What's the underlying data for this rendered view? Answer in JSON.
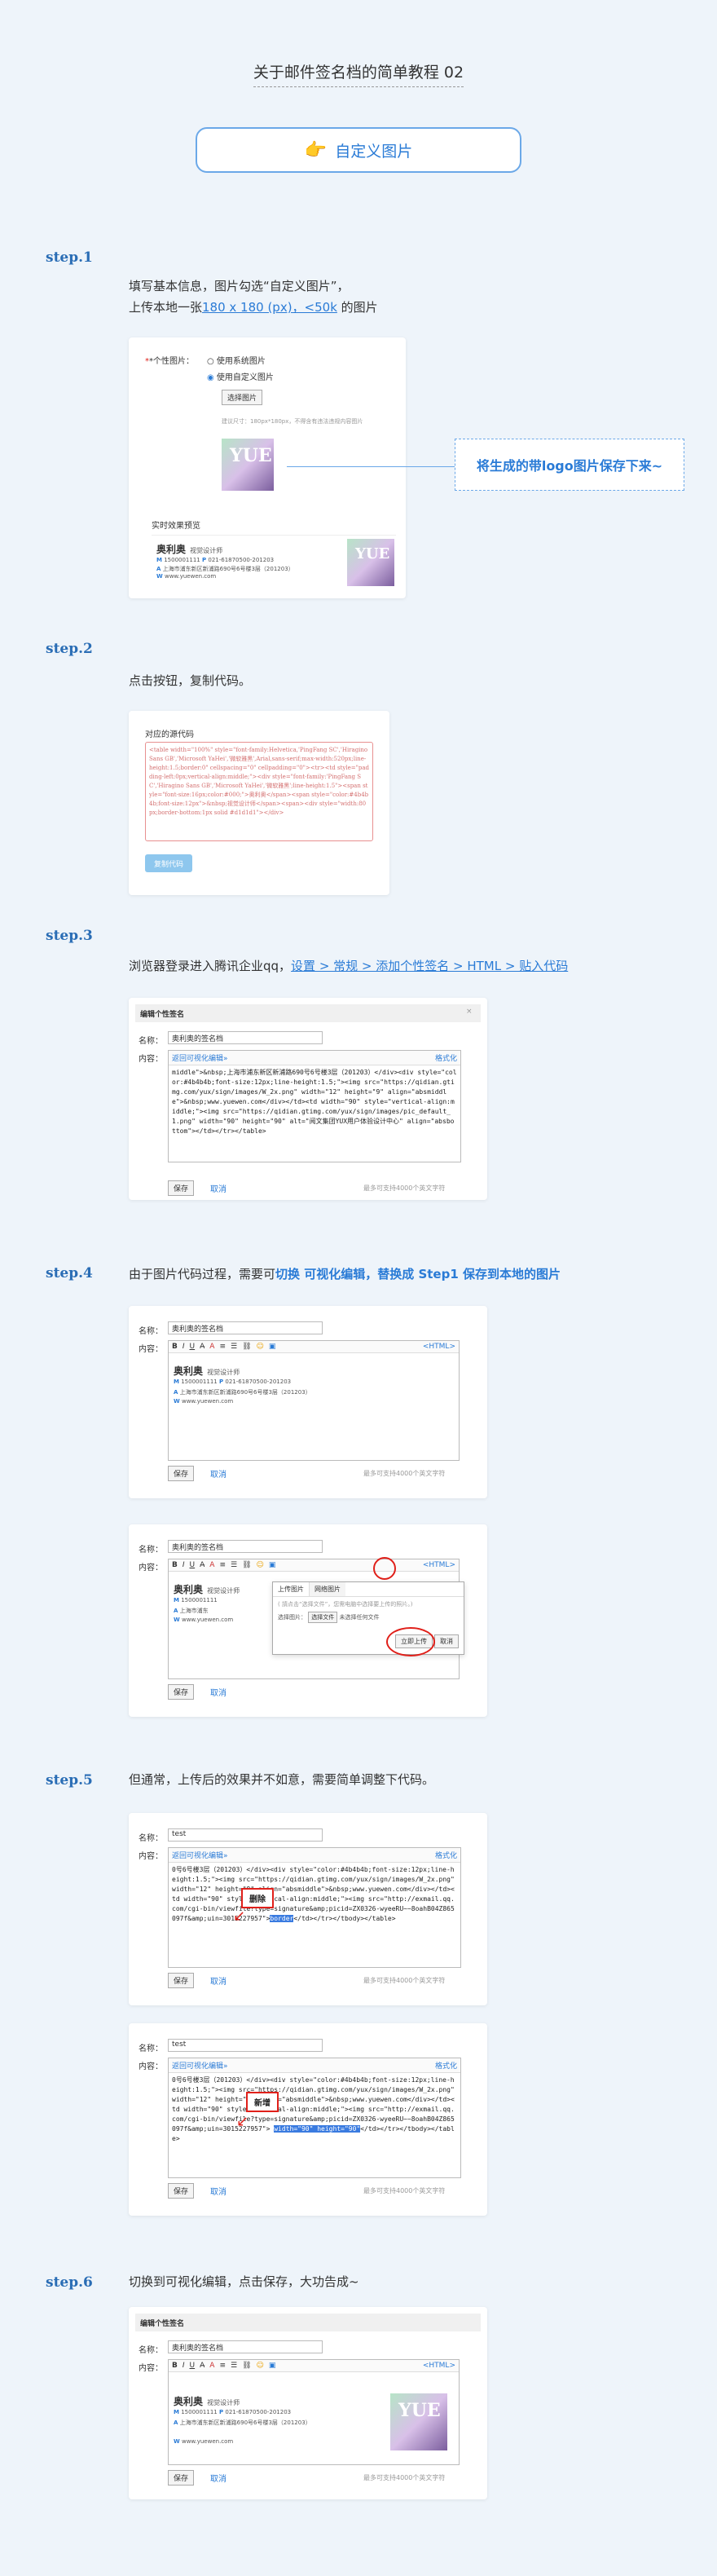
{
  "title": "关于邮件签名档的简单教程 02",
  "banner": {
    "label": "自定义图片",
    "icon": "pointing-hand-icon"
  },
  "step1": {
    "step": "step.1",
    "line1": "填写基本信息，图片勾选“自定义图片”，",
    "line2_prefix": "上传本地一张",
    "line2_link": "180 x 180 (px)，<50k",
    "line2_suffix": " 的图片",
    "form": {
      "label": "*个性图片：",
      "opt1": "使用系统图片",
      "opt2": "使用自定义图片",
      "choose": "选择图片",
      "hint": "建议尺寸：180px*180px，不得含有违法违规内容图片",
      "preview": "实时效果预览"
    },
    "callout": "将生成的带logo图片保存下来~"
  },
  "sig": {
    "name": "奥利奥",
    "role": "视觉设计师",
    "m_label": "M",
    "phone": "1500001111",
    "p_label": "P",
    "phone2": "021-61870500-201203",
    "a_label": "A",
    "addr": "上海市浦东新区新浦路690号6号楼3层（201203）",
    "w_label": "W",
    "web": "www.yuewen.com",
    "photo_text": "YUE"
  },
  "step2": {
    "step": "step.2",
    "text": "点击按钮，复制代码。",
    "heading": "对应的源代码",
    "code": "<table width=\"100%\" style=\"font-family:Helvetica,'PingFang SC','Hiragino Sans GB','Microsoft YaHei','微软雅黑',Arial,sans-serif;max-width:520px;line-height:1.5;border:0\" cellspacing=\"0\" cellpadding=\"0\"><tr><td style=\"padding-left:0px;vertical-align:middle;\"><div style=\"font-family:'PingFang SC','Hiragino Sans GB','Microsoft YaHei','微软雅黑';line-height:1.5\"><span style=\"font-size:16px;color:#000;\">奥利奥</span><span style=\"color:#4b4b4b;font-size:12px\">&nbsp;视觉设计师</span><span><div style=\"width:80px;border-bottom:1px solid #d1d1d1\"></div>",
    "button": "复制代码"
  },
  "step3": {
    "step": "step.3",
    "text_prefix": "浏览器登录进入腾讯企业qq，",
    "text_link": "设置 > 常规 > 添加个性签名 > HTML > 贴入代码",
    "dialog": {
      "title": "编辑个性签名",
      "name_label": "名称：",
      "name_value": "奥利奥的签名档",
      "content_label": "内容：",
      "back_link": "返回可视化编辑»",
      "format_link": "格式化",
      "code": "middle\">&nbsp;上海市浦东新区新浦路690号6号楼3层（201203）</div><div style=\"color:#4b4b4b;font-size:12px;line-height:1.5;\"><img src=\"https://qidian.gtimg.com/yux/sign/images/W_2x.png\" width=\"12\" height=\"9\" align=\"absmiddle\">&nbsp;www.yuewen.com</div></td><td width=\"90\" style=\"vertical-align:middle;\"><img src=\"https://qidian.gtimg.com/yux/sign/images/pic_default_1.png\" width=\"90\" height=\"90\" alt=\"阅文集团YUX用户体验设计中心\" align=\"absbottom\"></td></tr></table>",
      "save": "保存",
      "cancel": "取消",
      "limit": "最多可支持4000个英文字符"
    }
  },
  "step4": {
    "step": "step.4",
    "text_prefix": "由于图片代码过程，需要可",
    "text_bold": "切换 可视化编辑，替换成 Step1 保存到本地的图片",
    "toolbar": {
      "b": "B",
      "i": "I",
      "u": "U",
      "html": "<HTML>"
    },
    "upload": {
      "tab1": "上传图片",
      "tab2": "网络图片",
      "hint": "( 請点击“选择文件”，您需电脑中选择要上传的照片。)",
      "select_label": "选择图片：",
      "choose_file": "选择文件",
      "no_file": "未选择任何文件",
      "upload_btn": "立即上传",
      "cancel": "取消"
    }
  },
  "step5": {
    "step": "step.5",
    "text": "但通常，上传后的效果并不如意，需要简单调整下代码。",
    "name_label": "名称：",
    "name_value": "test",
    "content_label": "内容：",
    "code1": "0号6号楼3层（201203）</div><div style=\"color:#4b4b4b;font-size:12px;line-height:1.5;\"><img src=\"https://qidian.gtimg.com/yux/sign/images/W_2x.png\" width=\"12\" height=\"9\" align=\"absmiddle\">&nbsp;www.yuewen.com</div></td><td width=\"90\" style=\"vertical-align:middle;\"><img src=\"http://exmail.qq.com/cgi-bin/viewfile?type=signature&amp;picid=ZX0326-wyeeRU~~8oahB04Z865097f&amp;uin=3015227957\">",
    "del": "删除",
    "sel1": "border",
    "code1_tail": "</td></tr></tbody></table>",
    "add": "新增",
    "sel2": "width=\"90\" height=\"90\"",
    "code2_tail": "</td></tr></tbody></table>"
  },
  "step6": {
    "step": "step.6",
    "text": "切换到可视化编辑，点击保存，大功告成~"
  },
  "colors": {
    "accent": "#2a7bd6",
    "step": "#2a6db5",
    "red": "#e0201a"
  }
}
